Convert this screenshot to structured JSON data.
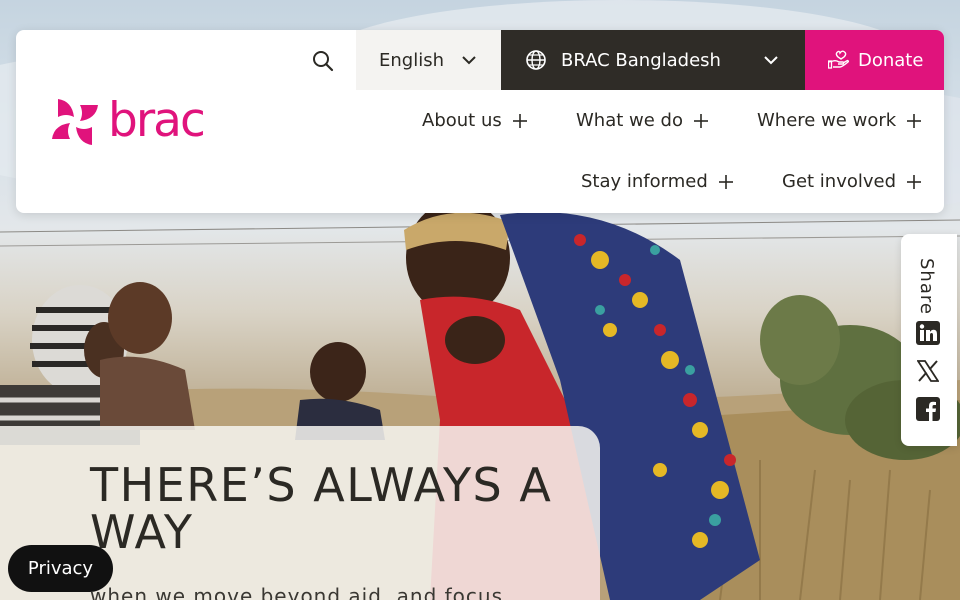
{
  "brand": {
    "logo_text": "brac",
    "accent_color": "#e0137c",
    "dark_color": "#2f2c27"
  },
  "header": {
    "search_icon": "search-icon",
    "language": {
      "label": "English",
      "icon": "chevron-down-icon"
    },
    "country": {
      "label": "BRAC Bangladesh",
      "icon": "globe-icon"
    },
    "donate": {
      "label": "Donate",
      "icon": "hand-heart-icon"
    }
  },
  "nav": {
    "items": [
      {
        "label": "About us"
      },
      {
        "label": "What we do"
      },
      {
        "label": "Where we work"
      },
      {
        "label": "Stay informed"
      },
      {
        "label": "Get involved"
      }
    ]
  },
  "share": {
    "label": "Share",
    "icons": [
      "linkedin-icon",
      "x-icon",
      "facebook-icon"
    ]
  },
  "hero": {
    "headline": "THERE’S ALWAYS A WAY",
    "subline": "when we move beyond aid, and focus"
  },
  "privacy": {
    "label": "Privacy"
  }
}
